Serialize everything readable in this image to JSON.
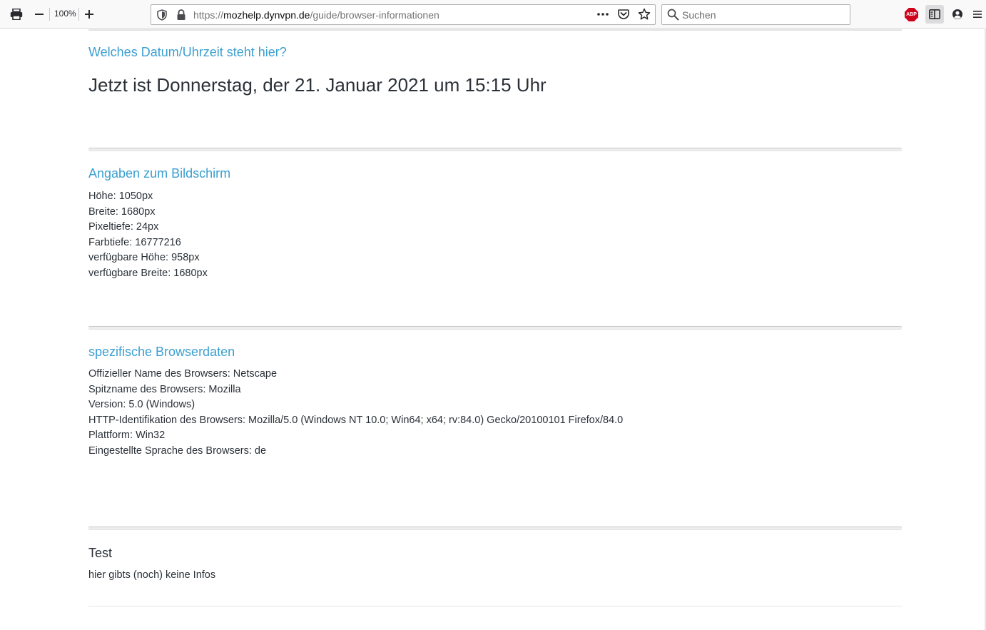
{
  "browser": {
    "zoom": "100%",
    "url_prefix": "https://",
    "url_host": "mozhelp.dynvpn.de",
    "url_path": "/guide/browser-informationen",
    "search_placeholder": "Suchen",
    "adblock_label": "ABP",
    "colors": {
      "toolbar_bg": "#f9f9fa",
      "adblock_red": "#d0021b"
    }
  },
  "page": {
    "colors": {
      "heading": "#3b9fd1",
      "text": "#2b3138"
    },
    "datetime": {
      "heading": "Welches Datum/Uhrzeit steht hier?",
      "statement": "Jetzt ist Donnerstag, der 21. Januar 2021 um 15:15 Uhr"
    },
    "screen": {
      "heading": "Angaben zum Bildschirm",
      "lines": [
        "Höhe: 1050px",
        "Breite: 1680px",
        "Pixeltiefe: 24px",
        "Farbtiefe: 16777216",
        "verfügbare Höhe: 958px",
        "verfügbare Breite: 1680px"
      ]
    },
    "browser_data": {
      "heading": "spezifische Browserdaten",
      "lines": [
        "Offizieller Name des Browsers: Netscape",
        "Spitzname des Browsers: Mozilla",
        "Version: 5.0 (Windows)",
        "HTTP-Identifikation des Browsers: Mozilla/5.0 (Windows NT 10.0; Win64; x64; rv:84.0) Gecko/20100101 Firefox/84.0",
        "Plattform: Win32",
        "Eingestellte Sprache des Browsers: de"
      ]
    },
    "test": {
      "heading": "Test",
      "text": "hier gibts (noch) keine Infos"
    }
  }
}
